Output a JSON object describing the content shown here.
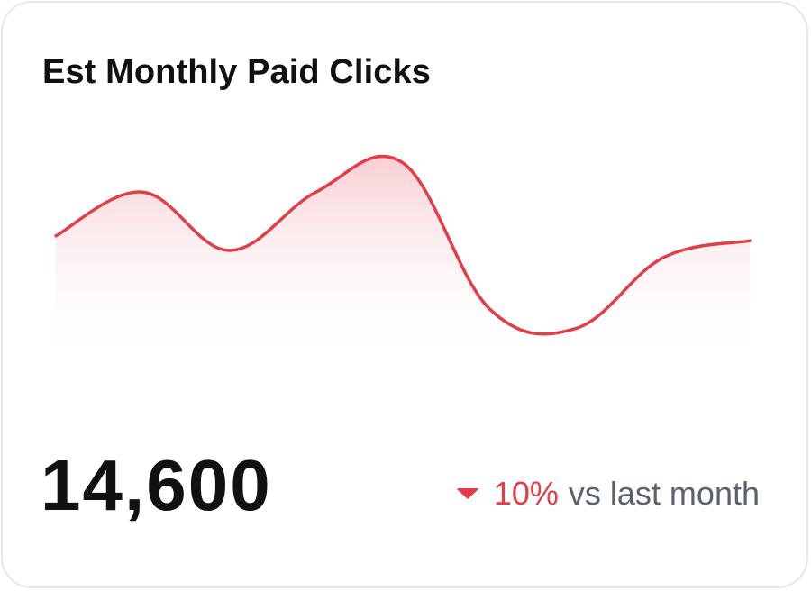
{
  "card": {
    "title": "Est Monthly Paid Clicks",
    "value": "14,600",
    "change": {
      "direction": "down",
      "percent": "10%",
      "label": "vs last month"
    }
  },
  "colors": {
    "line": "#e23d49",
    "fill_top": "#f9d3d7",
    "value_text": "#111111",
    "muted_text": "#5c6170"
  },
  "chart_data": {
    "type": "area",
    "x": [
      0,
      1,
      2,
      3,
      4,
      5,
      6,
      7,
      8
    ],
    "values": [
      56,
      74,
      50,
      74,
      86,
      26,
      18,
      47,
      54
    ],
    "ylim": [
      0,
      100
    ],
    "grid": false,
    "legend": "none",
    "xlabel": "",
    "ylabel": ""
  }
}
